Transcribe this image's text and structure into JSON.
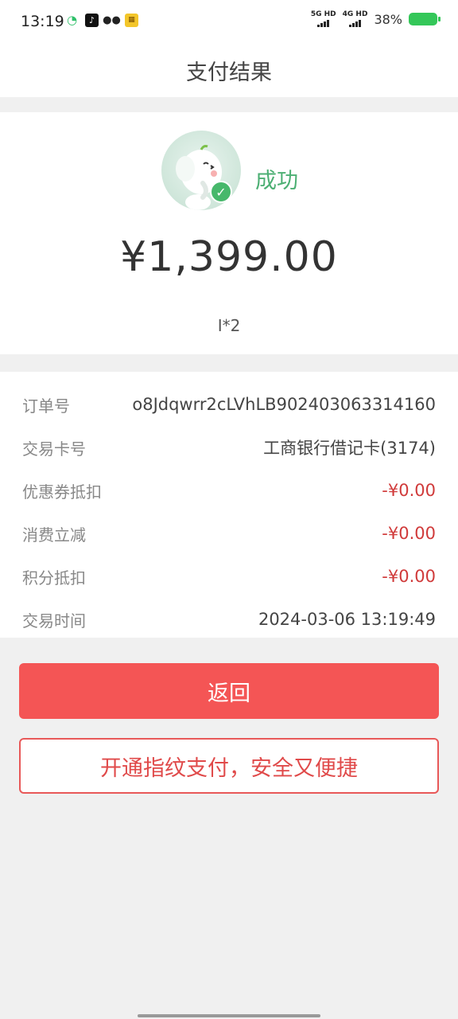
{
  "status_bar": {
    "time": "13:19",
    "icons": [
      "qq-icon",
      "tiktok-icon",
      "wechat-icon",
      "app-icon"
    ],
    "net1": "5G HD",
    "net2": "4G HD",
    "battery": "38%",
    "battery_color": "#34c759"
  },
  "header": {
    "title": "支付结果"
  },
  "result": {
    "status": "成功",
    "status_color": "#4caf73",
    "amount": "¥1,399.00",
    "goods": "I*2"
  },
  "details": [
    {
      "label": "订单号",
      "value": "o8Jdqwrr2cLVhLB902403063314160"
    },
    {
      "label": "交易卡号",
      "value": "工商银行借记卡(3174)"
    },
    {
      "label": "优惠券抵扣",
      "value": "-¥0.00"
    },
    {
      "label": "消费立减",
      "value": "-¥0.00"
    },
    {
      "label": "积分抵扣",
      "value": "-¥0.00"
    },
    {
      "label": "交易时间",
      "value": "2024-03-06 13:19:49"
    }
  ],
  "buttons": {
    "back": "返回",
    "fingerprint": "开通指纹支付，安全又便捷"
  },
  "colors": {
    "accent": "#f45555",
    "discount": "#d03a3a"
  }
}
